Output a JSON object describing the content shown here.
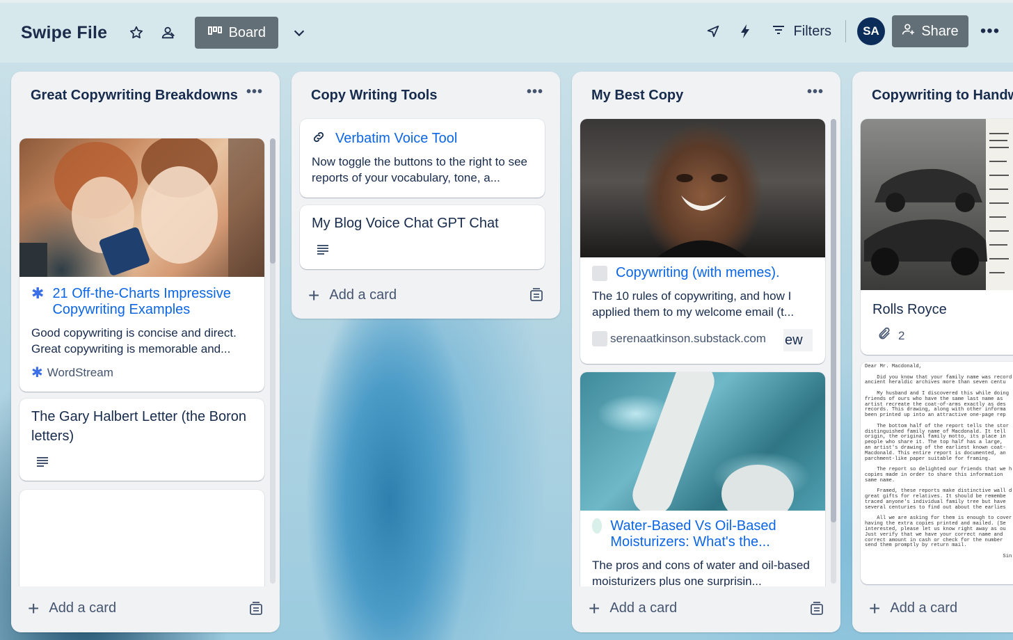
{
  "header": {
    "board_title": "Swipe File",
    "view_label": "Board",
    "filters_label": "Filters",
    "avatar_initials": "SA",
    "share_label": "Share"
  },
  "lists": [
    {
      "title": "Great Copywriting Breakdowns",
      "cards": [
        {
          "link_title": "21 Off-the-Charts Impressive Copywriting Examples",
          "description": "Good copywriting is concise and direct. Great copywriting is memorable and...",
          "source": "WordStream"
        },
        {
          "title": "The Gary Halbert Letter (the Boron letters)"
        }
      ],
      "add_card_label": "Add a card"
    },
    {
      "title": "Copy Writing Tools",
      "cards": [
        {
          "link_title": "Verbatim Voice Tool",
          "description": "Now toggle the buttons to the right to see reports of your vocabulary, tone, a..."
        },
        {
          "title": "My Blog Voice Chat GPT Chat"
        }
      ],
      "add_card_label": "Add a card"
    },
    {
      "title": "My Best Copy",
      "cards": [
        {
          "link_title": "Copywriting (with memes).",
          "description": "The 10 rules of copywriting, and how I applied them to my welcome email (t...",
          "source": "serenaatkinson.substack.com",
          "overflow_text": "ew"
        },
        {
          "link_title": "Water-Based Vs Oil-Based Moisturizers: What's the...",
          "description": "The pros and cons of water and oil-based moisturizers plus one surprisin..."
        }
      ],
      "add_card_label": "Add a card"
    },
    {
      "title": "Copywriting to Handw",
      "cards": [
        {
          "title": "Rolls Royce",
          "attachments": "2"
        },
        {
          "letter_text": [
            "Dear Mr. Macdonald,",
            "",
            "    Did you know that your family name was record",
            "ancient heraldic archives more than seven centu",
            "",
            "    My husband and I discovered this while doing",
            "friends of ours who have the same last name as",
            "artist recreate the coat-of-arms exactly as des",
            "records. This drawing, along with other informa",
            "been printed up into an attractive one-page rep",
            "",
            "    The bottom half of the report tells the stor",
            "distinguished family name of Macdonald. It tell",
            "origin, the original family motto, its place in",
            "people who share it. The top half has a large,",
            "an artist's drawing of the earliest known coat-",
            "Macdonald. This entire report is documented, an",
            "parchment-like paper suitable for framing.",
            "",
            "    The report so delighted our friends that we h",
            "copies made in order to share this information",
            "same name.",
            "",
            "    Framed, these reports make distinctive wall d",
            "great gifts for relatives. It should be remembe",
            "traced anyone's individual family tree but have",
            "several centuries to find out about the earlies",
            "",
            "    All we are asking for them is enough to cover",
            "having the extra copies printed and mailed. (Se",
            "interested, please let us know right away as ou",
            "Just verify that we have your correct name and",
            "correct amount in cash or check for the number",
            "send them promptly by return mail.",
            "",
            "                                              Sin"
          ]
        }
      ],
      "add_card_label": "Add a card"
    }
  ],
  "icons": {
    "star": "star-icon",
    "members": "members-icon",
    "board_view": "board-view-icon",
    "chevron": "chevron-down-icon",
    "power_ups": "rocket-icon",
    "automation": "lightning-icon",
    "filter": "filter-icon",
    "share": "add-person-icon",
    "more": "more-icon"
  },
  "colors": {
    "header_bg": "#d7e8ec",
    "button_bg": "#626f76",
    "link": "#0c66e4",
    "avatar_bg": "#0c2d5a",
    "list_bg": "#f1f2f4"
  }
}
